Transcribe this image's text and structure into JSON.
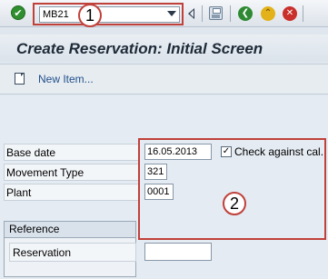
{
  "toolbar": {
    "command_value": "MB21",
    "icons": [
      "enter-check-icon",
      "dropdown-arrow-icon",
      "back-arrow-icon",
      "save-icon",
      "green-back-icon",
      "exit-icon",
      "cancel-icon"
    ]
  },
  "callouts": {
    "one": "1",
    "two": "2"
  },
  "page_title": "Create Reservation: Initial Screen",
  "app_toolbar": {
    "new_item": "New Item..."
  },
  "form": {
    "base_date_label": "Base date",
    "base_date_value": "16.05.2013",
    "check_label": "Check against cal.",
    "check_checked": true,
    "movement_type_label": "Movement Type",
    "movement_type_value": "321",
    "plant_label": "Plant",
    "plant_value": "0001"
  },
  "reference": {
    "title": "Reference",
    "reservation_label": "Reservation",
    "reservation_value": ""
  },
  "colors": {
    "annotation_red": "#c0413a",
    "link_blue": "#1f4f8a"
  }
}
